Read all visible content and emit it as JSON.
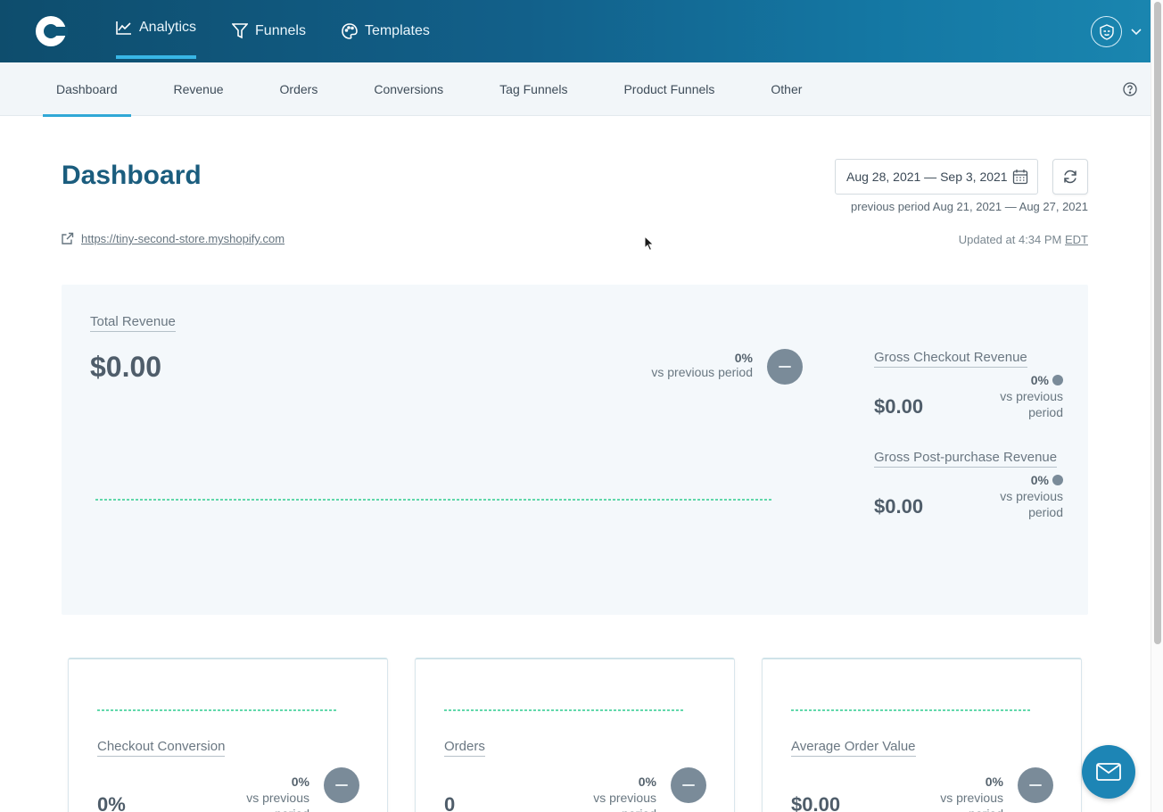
{
  "topnav": {
    "items": [
      {
        "label": "Analytics",
        "icon": "chart-line-icon",
        "active": true
      },
      {
        "label": "Funnels",
        "icon": "funnel-icon",
        "active": false
      },
      {
        "label": "Templates",
        "icon": "palette-icon",
        "active": false
      }
    ]
  },
  "subnav": {
    "items": [
      {
        "label": "Dashboard",
        "active": true
      },
      {
        "label": "Revenue",
        "active": false
      },
      {
        "label": "Orders",
        "active": false
      },
      {
        "label": "Conversions",
        "active": false
      },
      {
        "label": "Tag Funnels",
        "active": false
      },
      {
        "label": "Product Funnels",
        "active": false
      },
      {
        "label": "Other",
        "active": false
      }
    ]
  },
  "header": {
    "title": "Dashboard",
    "store_url": "https://tiny-second-store.myshopify.com",
    "date_range": "Aug 28, 2021 — Sep 3, 2021",
    "previous_period": "previous period Aug 21, 2021 — Aug 27, 2021",
    "updated_prefix": "Updated at 4:34 PM ",
    "updated_tz": "EDT"
  },
  "revenue_panel": {
    "total": {
      "label": "Total Revenue",
      "value": "$0.00",
      "pct": "0%",
      "vs": "vs previous period"
    },
    "gross_checkout": {
      "label": "Gross Checkout Revenue",
      "value": "$0.00",
      "pct": "0%",
      "vs": "vs previous period"
    },
    "gross_post_purchase": {
      "label": "Gross Post-purchase Revenue",
      "value": "$0.00",
      "pct": "0%",
      "vs": "vs previous period"
    }
  },
  "cards": [
    {
      "label": "Checkout Conversion",
      "value": "0%",
      "pct": "0%",
      "vs": "vs previous period"
    },
    {
      "label": "Orders",
      "value": "0",
      "pct": "0%",
      "vs": "vs previous period"
    },
    {
      "label": "Average Order Value",
      "value": "$0.00",
      "pct": "0%",
      "vs": "vs previous period"
    }
  ],
  "colors": {
    "accent": "#31a8d6",
    "title": "#1b5d7e",
    "neutral_badge": "#7a8b99",
    "sparkline": "#2ecc8f"
  }
}
